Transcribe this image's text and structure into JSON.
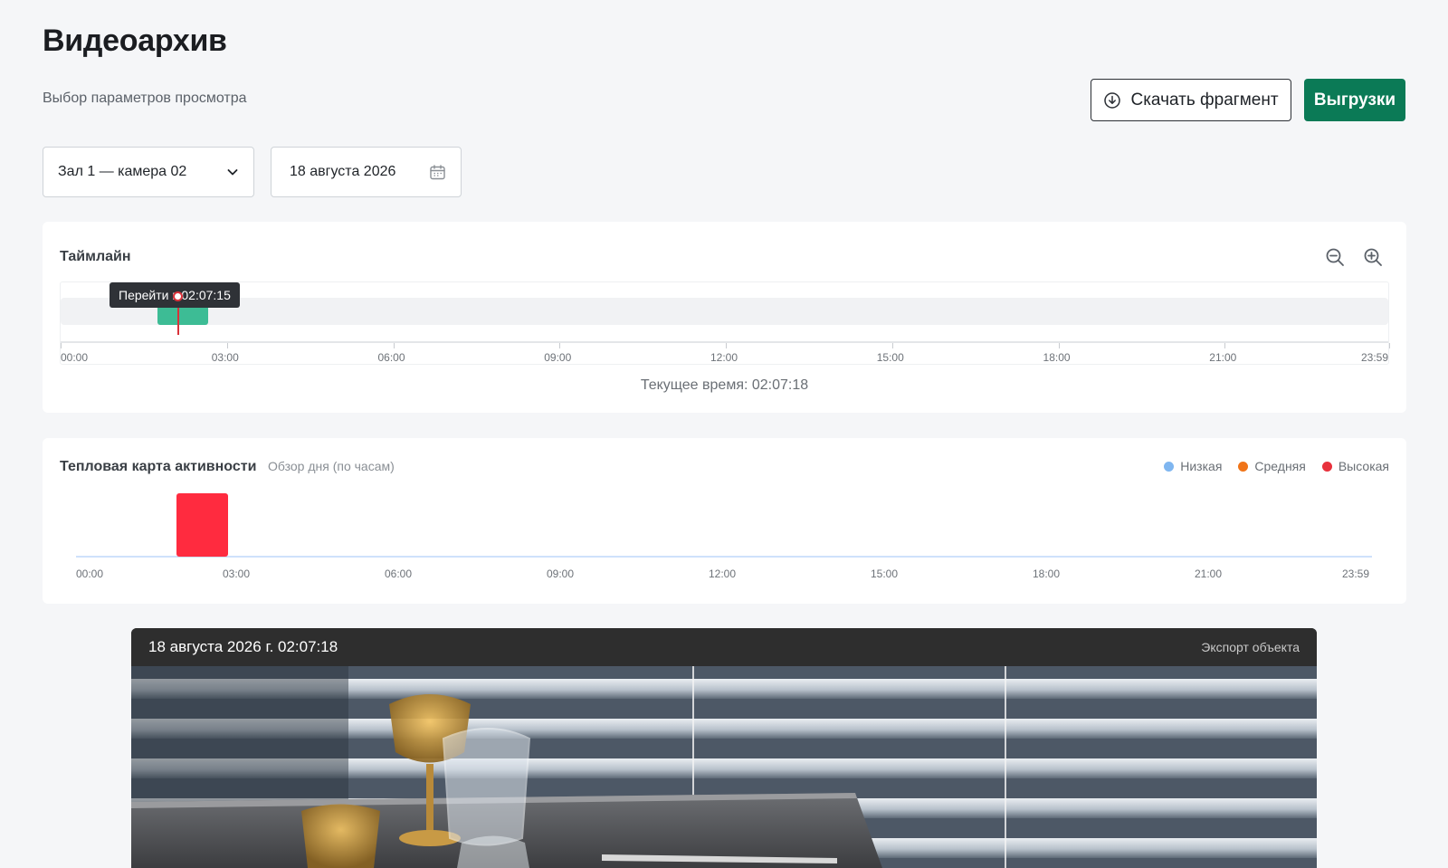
{
  "page": {
    "title": "Видеоархив",
    "subtitle": "Выбор параметров просмотра"
  },
  "actions": {
    "download_label": "Скачать фрагмент",
    "exports_label": "Выгрузки"
  },
  "filters": {
    "camera": "Зал 1 — камера 02",
    "date": "18 августа 2026"
  },
  "timeline": {
    "title": "Таймлайн",
    "tooltip": "Перейти к 02:07:15",
    "current_time_label": "Текущее время: 02:07:18",
    "ticks": [
      "00:00",
      "03:00",
      "06:00",
      "09:00",
      "12:00",
      "15:00",
      "18:00",
      "21:00",
      "23:59"
    ],
    "recording_segment": {
      "start": "01:45",
      "end": "02:40"
    },
    "cursor_time": "02:07:15"
  },
  "heatmap": {
    "title": "Тепловая карта активности",
    "subtitle": "Обзор дня (по часам)",
    "legend": [
      {
        "label": "Низкая",
        "color": "#7fb6f0"
      },
      {
        "label": "Средняя",
        "color": "#f07418"
      },
      {
        "label": "Высокая",
        "color": "#e8313c"
      }
    ],
    "ticks": [
      "00:00",
      "03:00",
      "06:00",
      "09:00",
      "12:00",
      "15:00",
      "18:00",
      "21:00",
      "23:59"
    ],
    "bars": [
      {
        "hour": 2,
        "level": "Высокая",
        "color": "#ff2b3f"
      }
    ]
  },
  "player": {
    "timestamp": "18 августа 2026 г. 02:07:18",
    "export_label": "Экспорт объекта"
  },
  "colors": {
    "accent": "#0b7a56",
    "segment": "#3dbc95",
    "cursor": "#d9323a"
  }
}
